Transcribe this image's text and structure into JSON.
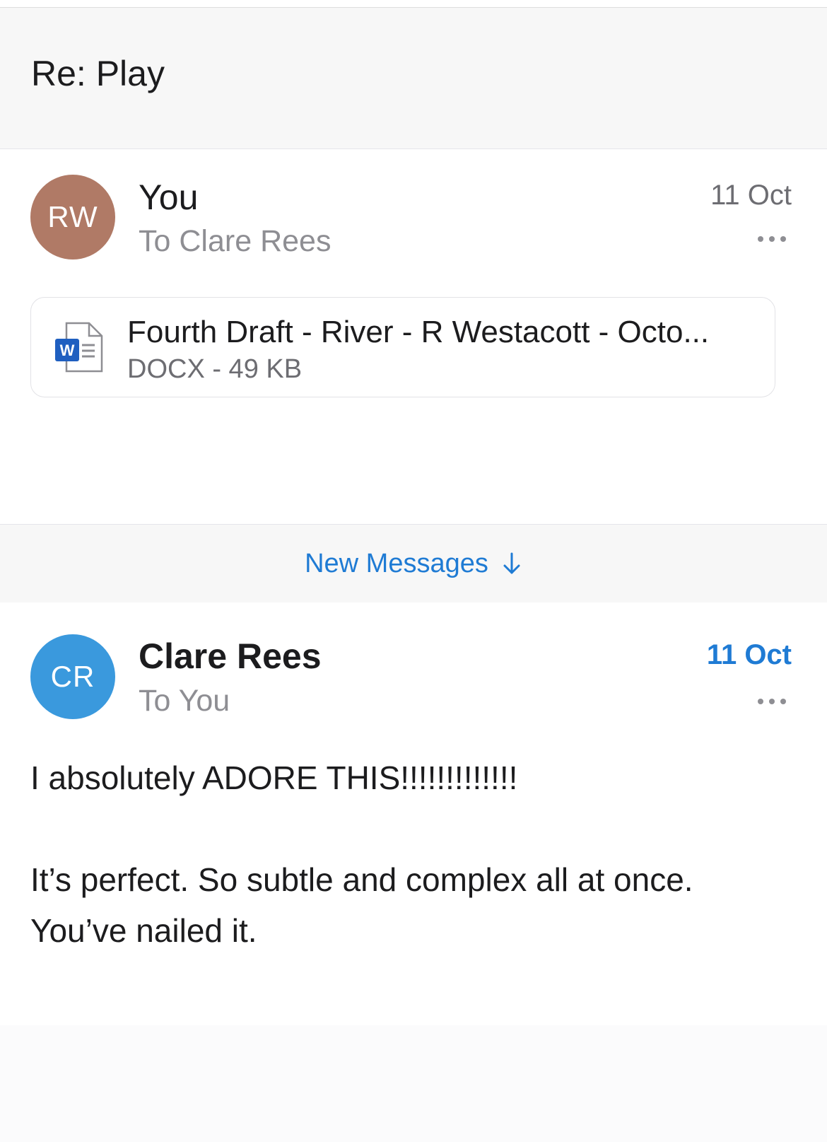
{
  "thread": {
    "subject": "Re: Play"
  },
  "messages": [
    {
      "avatar_initials": "RW",
      "avatar_color": "#b07a66",
      "sender": "You",
      "recipient": "To Clare Rees",
      "date": "11 Oct",
      "unread": false,
      "attachment": {
        "icon": "word-document-icon",
        "name": "Fourth Draft - River - R Westacott - Octo...",
        "meta": "DOCX - 49 KB"
      }
    },
    {
      "avatar_initials": "CR",
      "avatar_color": "#3a99dd",
      "sender": "Clare Rees",
      "recipient": "To You",
      "date": "11 Oct",
      "unread": true,
      "body": [
        "I absolutely ADORE THIS!!!!!!!!!!!!!",
        "It’s perfect. So subtle and complex all at once.",
        "You’ve nailed it."
      ]
    }
  ],
  "new_messages": {
    "label": "New Messages",
    "icon": "arrow-down-icon"
  },
  "colors": {
    "accent": "#1f7bd4",
    "header_bg": "#f7f7f7"
  }
}
